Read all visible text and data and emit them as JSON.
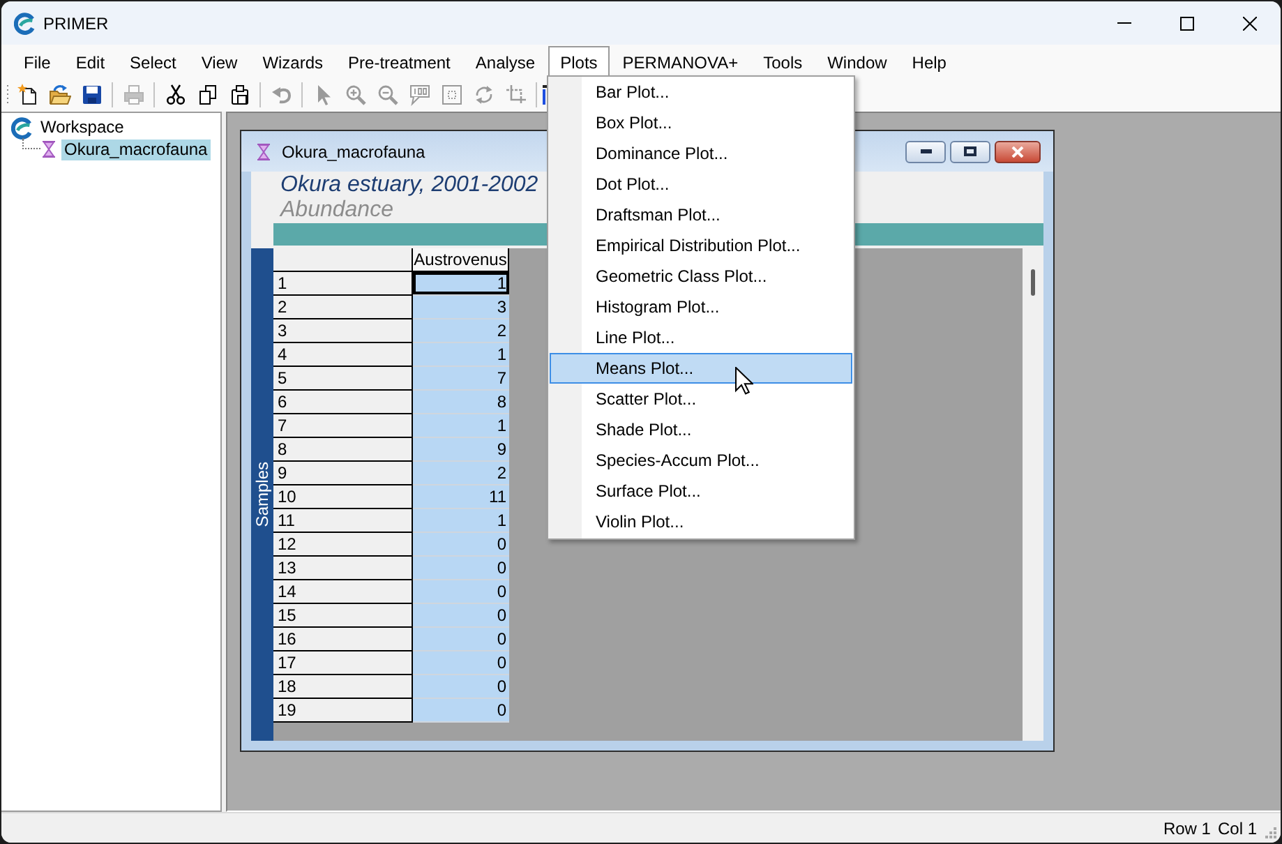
{
  "window": {
    "title": "PRIMER"
  },
  "menu_bar": [
    {
      "label": "File",
      "selected": false
    },
    {
      "label": "Edit",
      "selected": false
    },
    {
      "label": "Select",
      "selected": false
    },
    {
      "label": "View",
      "selected": false
    },
    {
      "label": "Wizards",
      "selected": false
    },
    {
      "label": "Pre-treatment",
      "selected": false
    },
    {
      "label": "Analyse",
      "selected": false
    },
    {
      "label": "Plots",
      "selected": true
    },
    {
      "label": "PERMANOVA+",
      "selected": false
    },
    {
      "label": "Tools",
      "selected": false
    },
    {
      "label": "Window",
      "selected": false
    },
    {
      "label": "Help",
      "selected": false
    }
  ],
  "toolbar": [
    [
      {
        "disabled": false
      },
      {
        "disabled": false
      },
      {
        "disabled": false
      }
    ],
    [
      {
        "disabled": true
      }
    ],
    [
      {
        "disabled": false
      },
      {
        "disabled": false
      },
      {
        "disabled": false
      }
    ],
    [
      {
        "disabled": true
      }
    ],
    [
      {
        "disabled": true
      },
      {
        "disabled": true
      },
      {
        "disabled": true
      },
      {
        "disabled": true
      },
      {
        "disabled": true
      },
      {
        "disabled": true
      },
      {
        "disabled": true
      }
    ],
    [
      {
        "disabled": false
      }
    ]
  ],
  "sidebar": {
    "tree": [
      {
        "label": "Workspace",
        "selected": false,
        "children": [
          {
            "label": "Okura_macrofauna",
            "selected": true
          }
        ]
      }
    ]
  },
  "document": {
    "title": "Okura_macrofauna",
    "heading": "Okura estuary, 2001-2002",
    "subheading": "Abundance",
    "row_axis_label": "Samples",
    "table": {
      "columns": [
        {
          "label": "Austrovenus",
          "selected": true
        }
      ],
      "rows": [
        {
          "label": "1",
          "values": [
            "1"
          ],
          "focused": true
        },
        {
          "label": "2",
          "values": [
            "3"
          ],
          "focused": false
        },
        {
          "label": "3",
          "values": [
            "2"
          ],
          "focused": false
        },
        {
          "label": "4",
          "values": [
            "1"
          ],
          "focused": false
        },
        {
          "label": "5",
          "values": [
            "7"
          ],
          "focused": false
        },
        {
          "label": "6",
          "values": [
            "8"
          ],
          "focused": false
        },
        {
          "label": "7",
          "values": [
            "1"
          ],
          "focused": false
        },
        {
          "label": "8",
          "values": [
            "9"
          ],
          "focused": false
        },
        {
          "label": "9",
          "values": [
            "2"
          ],
          "focused": false
        },
        {
          "label": "10",
          "values": [
            "11"
          ],
          "focused": false
        },
        {
          "label": "11",
          "values": [
            "1"
          ],
          "focused": false
        },
        {
          "label": "12",
          "values": [
            "0"
          ],
          "focused": false
        },
        {
          "label": "13",
          "values": [
            "0"
          ],
          "focused": false
        },
        {
          "label": "14",
          "values": [
            "0"
          ],
          "focused": false
        },
        {
          "label": "15",
          "values": [
            "0"
          ],
          "focused": false
        },
        {
          "label": "16",
          "values": [
            "0"
          ],
          "focused": false
        },
        {
          "label": "17",
          "values": [
            "0"
          ],
          "focused": false
        },
        {
          "label": "18",
          "values": [
            "0"
          ],
          "focused": false
        },
        {
          "label": "19",
          "values": [
            "0"
          ],
          "focused": false
        }
      ]
    }
  },
  "plots_menu": {
    "items": [
      {
        "label": "Bar Plot...",
        "selected": false
      },
      {
        "label": "Box Plot...",
        "selected": false
      },
      {
        "label": "Dominance Plot...",
        "selected": false
      },
      {
        "label": "Dot Plot...",
        "selected": false
      },
      {
        "label": "Draftsman Plot...",
        "selected": false
      },
      {
        "label": "Empirical Distribution Plot...",
        "selected": false
      },
      {
        "label": "Geometric Class Plot...",
        "selected": false
      },
      {
        "label": "Histogram Plot...",
        "selected": false
      },
      {
        "label": "Line Plot...",
        "selected": false
      },
      {
        "label": "Means Plot...",
        "selected": true
      },
      {
        "label": "Scatter Plot...",
        "selected": false
      },
      {
        "label": "Shade Plot...",
        "selected": false
      },
      {
        "label": "Species-Accum Plot...",
        "selected": false
      },
      {
        "label": "Surface Plot...",
        "selected": false
      },
      {
        "label": "Violin Plot...",
        "selected": false
      }
    ]
  },
  "status_bar": [
    "Row 1",
    "Col 1"
  ]
}
